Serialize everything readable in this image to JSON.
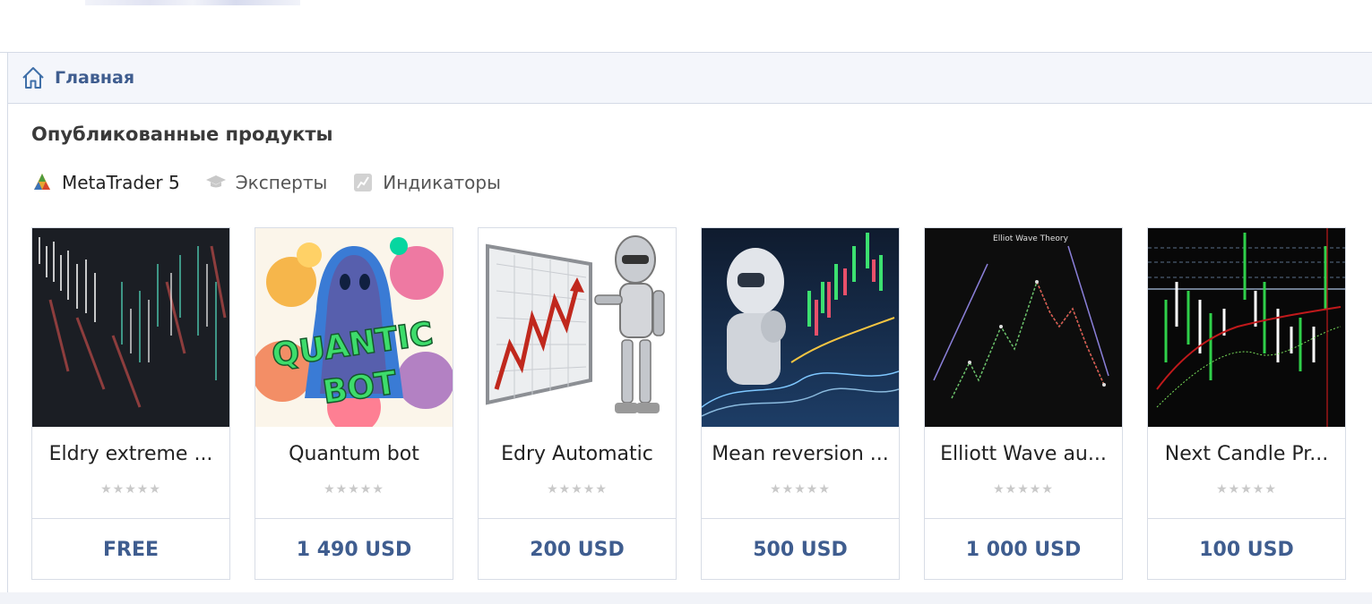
{
  "breadcrumb": {
    "label": "Главная"
  },
  "section": {
    "title": "Опубликованные продукты"
  },
  "filters": [
    {
      "label": "MetaTrader 5",
      "icon": "metatrader-icon",
      "active": true
    },
    {
      "label": "Эксперты",
      "icon": "graduation-cap-icon",
      "active": false
    },
    {
      "label": "Индикаторы",
      "icon": "indicator-icon",
      "active": false
    }
  ],
  "products": [
    {
      "name": "Eldry extreme ...",
      "rating": "★★★★★",
      "price": "FREE",
      "thumb": "trading-chart-blur-thumbnail"
    },
    {
      "name": "Quantum bot",
      "rating": "★★★★★",
      "price": "1 490 USD",
      "thumb": "ghost-quantic-bot-thumbnail"
    },
    {
      "name": "Edry Automatic",
      "rating": "★★★★★",
      "price": "200 USD",
      "thumb": "robot-chart-board-thumbnail"
    },
    {
      "name": "Mean reversion ...",
      "rating": "★★★★★",
      "price": "500 USD",
      "thumb": "robot-thinking-chart-thumbnail"
    },
    {
      "name": "Elliott Wave au...",
      "rating": "★★★★★",
      "price": "1 000 USD",
      "thumb": "elliott-wave-theory-thumbnail",
      "thumb_text": "Elliot Wave Theory"
    },
    {
      "name": "Next Candle Pr...",
      "rating": "★★★★★",
      "price": "100 USD",
      "thumb": "candle-chart-thumbnail"
    }
  ],
  "colors": {
    "accent": "#3f5d8f",
    "border": "#d8dde6",
    "breadcrumb_bg": "#f4f6fb"
  }
}
